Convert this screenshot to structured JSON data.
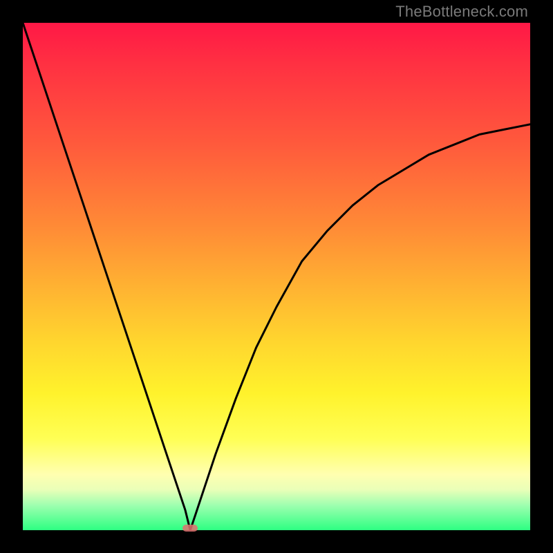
{
  "watermark": "TheBottleneck.com",
  "chart_data": {
    "type": "line",
    "title": "",
    "xlabel": "",
    "ylabel": "",
    "xlim": [
      0,
      100
    ],
    "ylim": [
      0,
      100
    ],
    "grid": false,
    "legend": false,
    "notes": "Black V-shaped curve over a vertical rainbow gradient. Left branch is steep/near-linear; right branch rises and flattens. Minimum is at ~x=33 where y≈0. A small reddish marker sits at the valley bottom.",
    "x": [
      0,
      4,
      8,
      12,
      16,
      20,
      24,
      28,
      32,
      33,
      34,
      38,
      42,
      46,
      50,
      55,
      60,
      65,
      70,
      75,
      80,
      85,
      90,
      95,
      100
    ],
    "values": [
      100,
      88,
      76,
      64,
      52,
      40,
      28,
      16,
      4,
      0,
      3,
      15,
      26,
      36,
      44,
      53,
      59,
      64,
      68,
      71,
      74,
      76,
      78,
      79,
      80
    ],
    "marker": {
      "x": 33,
      "y": 0
    },
    "background_gradient": {
      "direction": "top-to-bottom",
      "stops": [
        {
          "pos": 0.0,
          "color": "#ff1846"
        },
        {
          "pos": 0.4,
          "color": "#ff8a36"
        },
        {
          "pos": 0.73,
          "color": "#fff22c"
        },
        {
          "pos": 0.92,
          "color": "#eaffb8"
        },
        {
          "pos": 1.0,
          "color": "#2dff82"
        }
      ]
    }
  }
}
